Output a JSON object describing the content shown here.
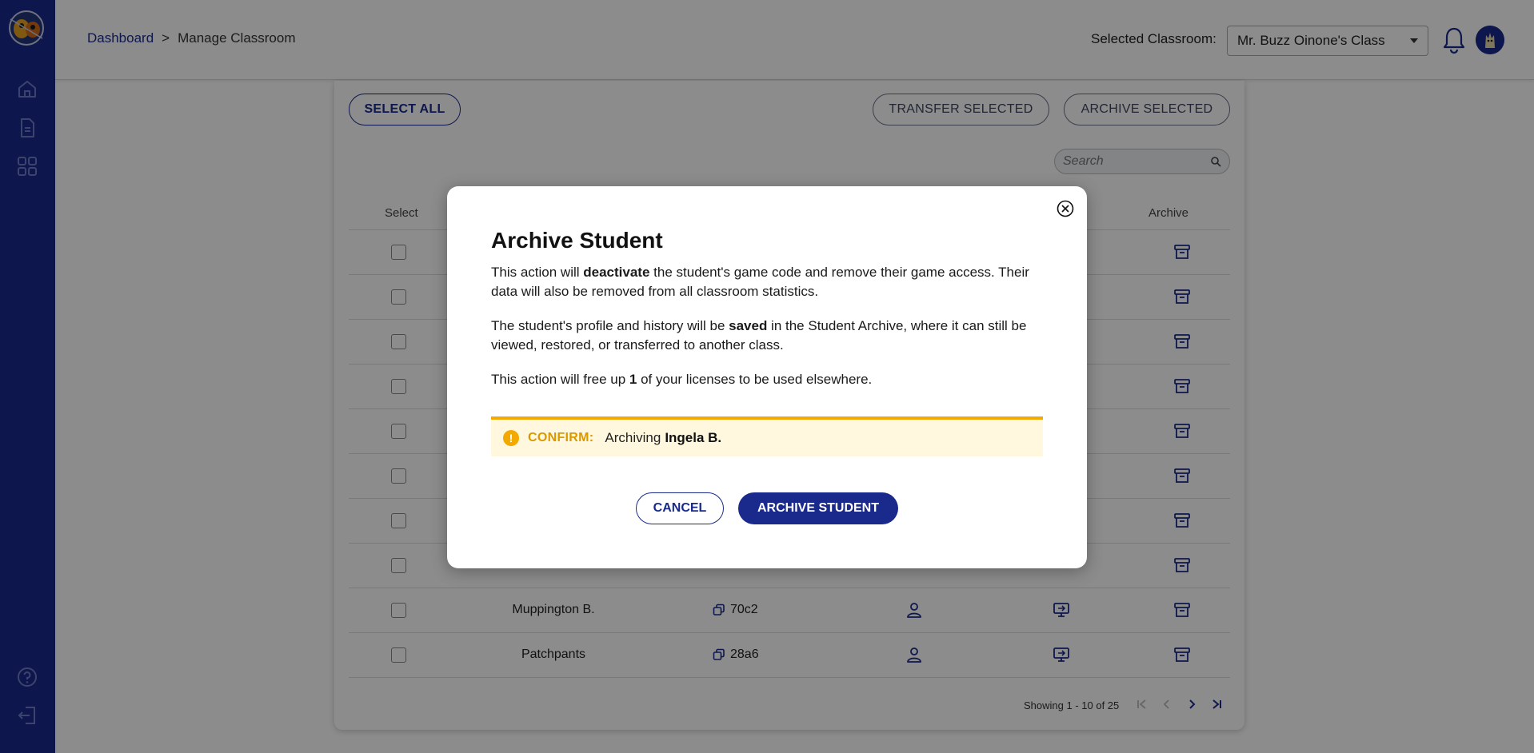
{
  "header": {
    "breadcrumb": {
      "home": "Dashboard",
      "separator": ">",
      "current": "Manage Classroom"
    },
    "classroom_label": "Selected Classroom:",
    "classroom_value": "Mr. Buzz Oinone's Class"
  },
  "sidebar": {
    "icons": [
      "home-icon",
      "document-icon",
      "grid-icon",
      "help-icon",
      "logout-icon"
    ]
  },
  "toolbar": {
    "select_all": "SELECT ALL",
    "transfer_selected": "TRANSFER SELECTED",
    "archive_selected": "ARCHIVE SELECTED",
    "search_placeholder": "Search"
  },
  "table": {
    "headers": {
      "select": "Select",
      "archive": "Archive"
    },
    "rows": [
      {
        "name": "",
        "code": ""
      },
      {
        "name": "",
        "code": ""
      },
      {
        "name": "",
        "code": ""
      },
      {
        "name": "",
        "code": ""
      },
      {
        "name": "",
        "code": ""
      },
      {
        "name": "",
        "code": ""
      },
      {
        "name": "",
        "code": ""
      },
      {
        "name": "",
        "code": ""
      },
      {
        "name": "Muppington B.",
        "code": "70c2"
      },
      {
        "name": "Patchpants",
        "code": "28a6"
      }
    ]
  },
  "pagination": {
    "showing": "Showing 1 - 10 of 25"
  },
  "modal": {
    "title": "Archive Student",
    "p1_a": "This action will ",
    "p1_b": "deactivate",
    "p1_c": " the student's game code and remove their game access. Their data will also be removed from all classroom statistics.",
    "p2_a": "The student's profile and history will be ",
    "p2_b": "saved",
    "p2_c": " in the Student Archive, where it can still be viewed, restored, or transferred to another class.",
    "p3_a": "This action will free up ",
    "p3_b": "1",
    "p3_c": " of your licenses to be used elsewhere.",
    "confirm_label": "CONFIRM:",
    "confirm_text": "Archiving",
    "confirm_name": "Ingela B.",
    "cancel": "CANCEL",
    "archive": "ARCHIVE STUDENT"
  },
  "colors": {
    "brand": "#1a2a8c",
    "warning": "#f2a900",
    "warning_bg": "#fff8df"
  }
}
